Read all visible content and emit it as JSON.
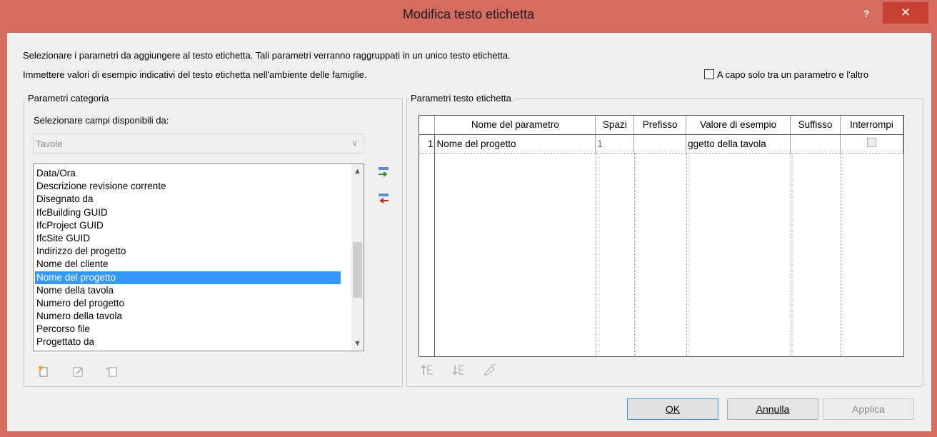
{
  "window": {
    "title": "Modifica testo etichetta",
    "help": "?",
    "close": "✕"
  },
  "intro": {
    "line1": "Selezionare i parametri da aggiungere al testo etichetta. Tali parametri verranno raggruppati in un unico testo etichetta.",
    "line2": "Immettere valori di esempio indicativi del testo etichetta nell'ambiente delle famiglie.",
    "wrap_label": "A capo solo tra un parametro e l'altro",
    "wrap_checked": false
  },
  "left_group": {
    "legend": "Parametri categoria",
    "select_label": "Selezionare campi disponibili da:",
    "combo_value": "Tavole",
    "items": [
      "Data/Ora",
      "Descrizione revisione corrente",
      "Disegnato da",
      "IfcBuilding GUID",
      "IfcProject GUID",
      "IfcSite GUID",
      "Indirizzo del progetto",
      "Nome del cliente",
      "Nome del progetto",
      "Nome della tavola",
      "Numero del progetto",
      "Numero della tavola",
      "Percorso file",
      "Progettato da"
    ],
    "selected_item": "Nome del progetto",
    "tool_icons": [
      "new-parameter-icon",
      "edit-parameter-icon",
      "delete-parameter-icon"
    ]
  },
  "move_buttons": [
    "add-parameter-icon",
    "remove-parameter-icon"
  ],
  "right_group": {
    "legend": "Parametri testo etichetta",
    "columns": [
      "Nome del parametro",
      "Spazi",
      "Prefisso",
      "Valore di esempio",
      "Suffisso",
      "Interrompi"
    ],
    "rows": [
      {
        "num": "1",
        "name": "Nome del progetto",
        "spaces": "1",
        "prefix": "",
        "sample": "ggetto della tavola",
        "suffix": "",
        "break": false
      }
    ],
    "tool_icons": [
      "move-up-icon",
      "move-down-icon",
      "format-icon"
    ]
  },
  "buttons": {
    "ok": "OK",
    "cancel": "Annulla",
    "apply": "Applica"
  },
  "colors": {
    "titlebar": "#d66b5f",
    "close": "#c84031",
    "selection": "#3399ff"
  }
}
